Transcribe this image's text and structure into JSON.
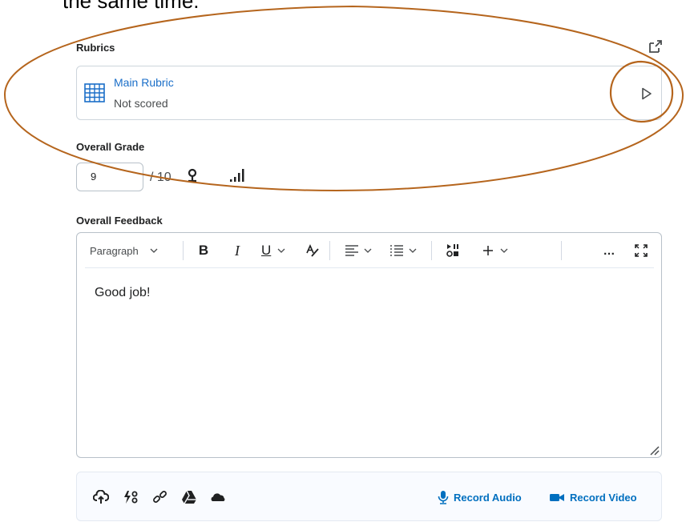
{
  "caption": "the same time.",
  "rubrics": {
    "label": "Rubrics",
    "expand_icon": "expand-popout-icon",
    "card": {
      "icon": "rubric-grid-icon",
      "name": "Main Rubric",
      "status": "Not scored",
      "open_icon": "play-arrow-icon"
    }
  },
  "grade": {
    "label": "Overall Grade",
    "value": "9",
    "out_of": "/ 10",
    "icons": [
      "pin-icon",
      "bar-chart-icon"
    ]
  },
  "feedback": {
    "label": "Overall Feedback",
    "toolbar": {
      "paragraph_label": "Paragraph",
      "bold": "B",
      "italic": "I",
      "underline": "U",
      "more": "…"
    },
    "content": "Good job!"
  },
  "attachments": {
    "icons": [
      "upload-icon",
      "quicklink-icon",
      "link-icon",
      "google-drive-icon",
      "onedrive-icon"
    ],
    "record_audio": "Record Audio",
    "record_video": "Record Video"
  },
  "colors": {
    "link": "#1a6ec8",
    "annotation": "#b5651d",
    "record": "#006fbf"
  }
}
